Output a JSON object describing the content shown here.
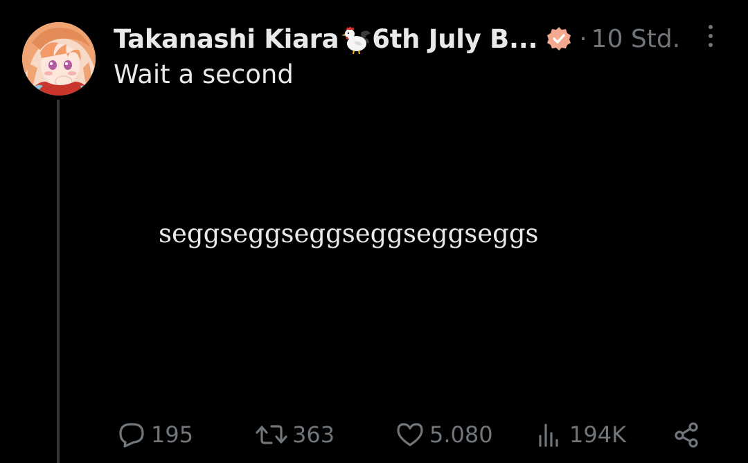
{
  "tweet": {
    "author": {
      "display_name": "Takanashi Kiara",
      "display_name_suffix": "6th July B...",
      "name_emoji": "rooster-icon",
      "verified_badge": "verified-icon",
      "avatar": "avatar"
    },
    "separator": "·",
    "timestamp": "10 Std.",
    "text": "Wait a second",
    "media_text": "seggseggseggseggseggseggs",
    "actions": {
      "reply": {
        "icon": "reply-icon",
        "count": "195"
      },
      "repost": {
        "icon": "repost-icon",
        "count": "363"
      },
      "like": {
        "icon": "heart-icon",
        "count": "5.080"
      },
      "views": {
        "icon": "views-icon",
        "count": "194K"
      },
      "share": {
        "icon": "share-icon"
      }
    },
    "more_menu": "more-icon"
  },
  "colors": {
    "background": "#000000",
    "primary_text": "#e7e9ea",
    "secondary_text": "#71767b",
    "thread_line": "#333639",
    "verified_badge": "#f4a88e"
  }
}
